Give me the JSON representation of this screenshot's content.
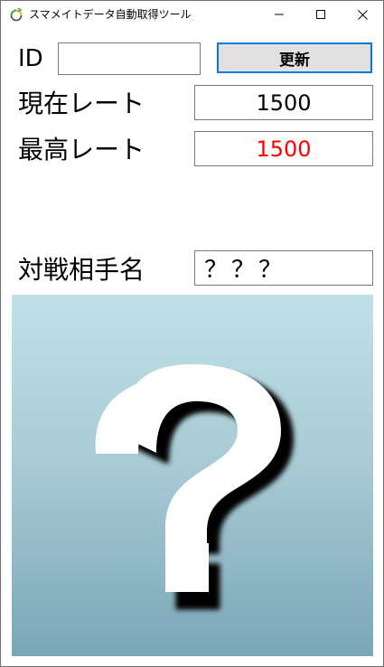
{
  "window": {
    "title": "スマメイトデータ自動取得ツール",
    "controls": {
      "minimize_icon": "minimize-icon",
      "maximize_icon": "maximize-icon",
      "close_icon": "close-icon"
    }
  },
  "form": {
    "id_label": "ID",
    "id_value": "",
    "update_button": "更新",
    "current_rate_label": "現在レート",
    "current_rate_value": "1500",
    "max_rate_label": "最高レート",
    "max_rate_value": "1500",
    "max_rate_color": "#ff0000",
    "opponent_label": "対戦相手名",
    "opponent_value": "？？？"
  },
  "avatar": {
    "icon": "question-mark-icon",
    "gradient_top": "#c0e1e7",
    "gradient_bottom": "#7aa6b7"
  },
  "colors": {
    "accent": "#0078d7",
    "button_bg": "#e1e1e1"
  }
}
